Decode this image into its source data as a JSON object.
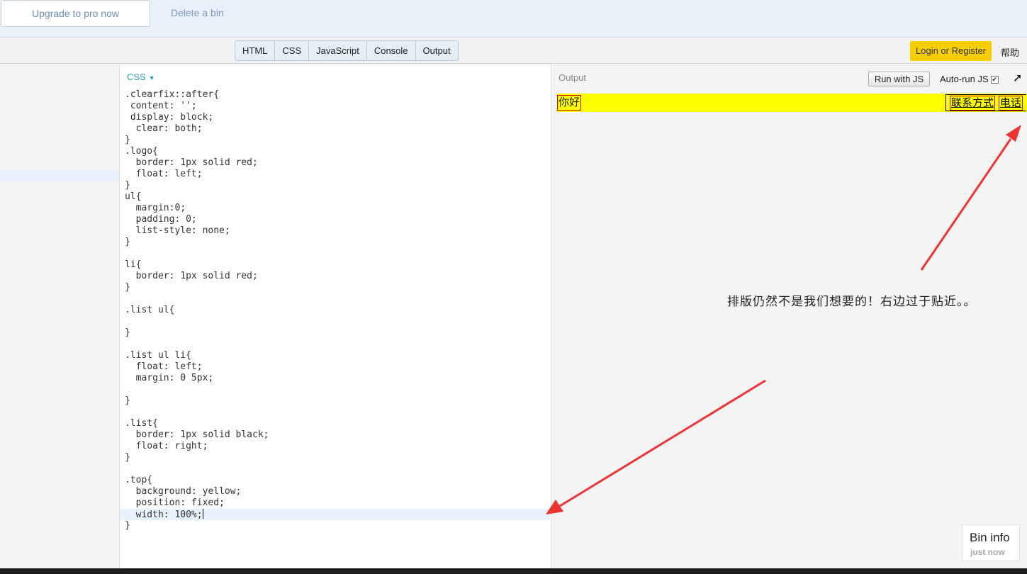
{
  "banner": {
    "upgrade_label": "Upgrade to pro now",
    "delete_label": "Delete a bin"
  },
  "toolbar": {
    "tabs": [
      "HTML",
      "CSS",
      "JavaScript",
      "Console",
      "Output"
    ],
    "login_label": "Login or Register",
    "help_label": "帮助"
  },
  "editor": {
    "label": "CSS",
    "lines": [
      ".clearfix::after{",
      " content: '';",
      " display: block;",
      "  clear: both;",
      "}",
      ".logo{",
      "  border: 1px solid red;",
      "  float: left;",
      "}",
      "ul{",
      "  margin:0;",
      "  padding: 0;",
      "  list-style: none;",
      "}",
      "",
      "li{",
      "  border: 1px solid red;",
      "}",
      "",
      ".list ul{",
      "",
      "}",
      "",
      ".list ul li{",
      "  float: left;",
      "  margin: 0 5px;",
      "",
      "}",
      "",
      ".list{",
      "  border: 1px solid black;",
      "  float: right;",
      "}",
      "",
      ".top{",
      "  background: yellow;",
      "  position: fixed;",
      "  width: 100%;",
      "}"
    ],
    "active_line": 37
  },
  "output": {
    "label": "Output",
    "run_label": "Run with JS",
    "autorun_label": "Auto-run JS",
    "autorun_checked": true,
    "popout_icon": "external-link-icon",
    "demo_logo": "你好",
    "demo_items": [
      "联系方式",
      "电话"
    ],
    "demo_bg": "#ffff00",
    "annotation": "排版仍然不是我们想要的！右边过于贴近。。",
    "bin_info_title": "Bin info",
    "bin_info_sub": "just now"
  },
  "colors": {
    "arrow": "#ee3333",
    "login_bg": "#f7cf00",
    "editor_label": "#2a9fc4"
  }
}
